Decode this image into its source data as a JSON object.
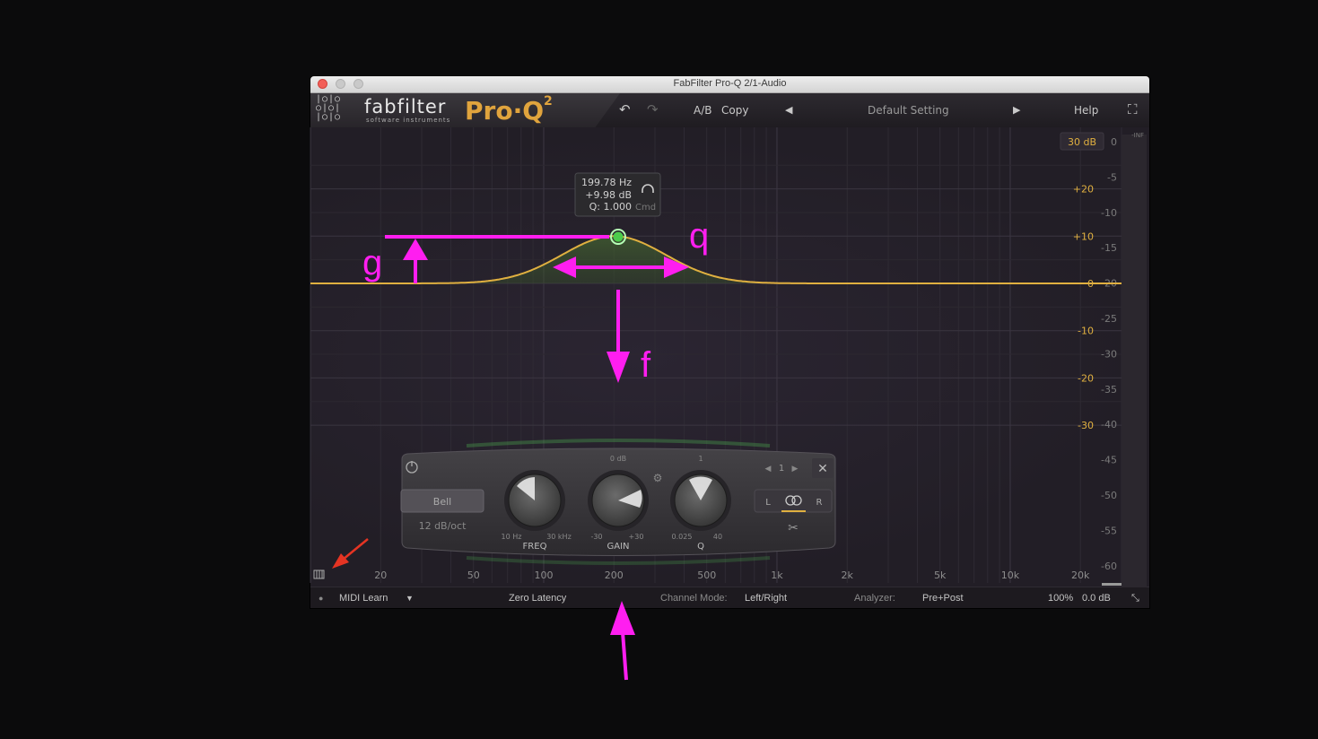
{
  "window": {
    "title": "FabFilter Pro-Q 2/1-Audio"
  },
  "header": {
    "brand": "fabfilter",
    "brand_sub": "software instruments",
    "product": "Pro·Q",
    "product_version": "2",
    "ab_label": "A/B",
    "copy_label": "Copy",
    "preset_name": "Default Setting",
    "help_label": "Help"
  },
  "graph": {
    "range_label": "30 dB",
    "inf_label": "-INF",
    "gain_scale": [
      "+20",
      "+10",
      "0",
      "-10",
      "-20",
      "-30"
    ],
    "analyzer_scale": [
      "0",
      "-5",
      "-10",
      "-15",
      "-20",
      "-25",
      "-30",
      "-35",
      "-40",
      "-45",
      "-50",
      "-55",
      "-60"
    ],
    "freq_labels": [
      "20",
      "50",
      "100",
      "200",
      "500",
      "1k",
      "2k",
      "5k",
      "10k",
      "20k"
    ],
    "accent_color": "#e0b040",
    "node_color": "#4ccc4c"
  },
  "tooltip": {
    "freq": "199.78 Hz",
    "gain": "+9.98 dB",
    "q": "Q: 1.000",
    "modifier": "Cmd"
  },
  "band_panel": {
    "shape": "Bell",
    "slope": "12 dB/oct",
    "band_number": "1",
    "freq_label": "FREQ",
    "freq_min": "10 Hz",
    "freq_max": "30 kHz",
    "gain_label": "GAIN",
    "gain_top": "0 dB",
    "gain_min": "-30",
    "gain_max": "+30",
    "q_label": "Q",
    "q_top": "1",
    "q_min": "0.025",
    "q_max": "40",
    "left_label": "L",
    "right_label": "R"
  },
  "statusbar": {
    "midi_learn": "MIDI Learn",
    "latency": "Zero Latency",
    "channel_mode_label": "Channel Mode:",
    "channel_mode": "Left/Right",
    "analyzer_label": "Analyzer:",
    "analyzer": "Pre+Post",
    "zoom": "100%",
    "output_gain": "0.0 dB"
  },
  "annotations": {
    "gain": "g",
    "q": "q",
    "freq": "f",
    "color": "#ff1ef0"
  }
}
